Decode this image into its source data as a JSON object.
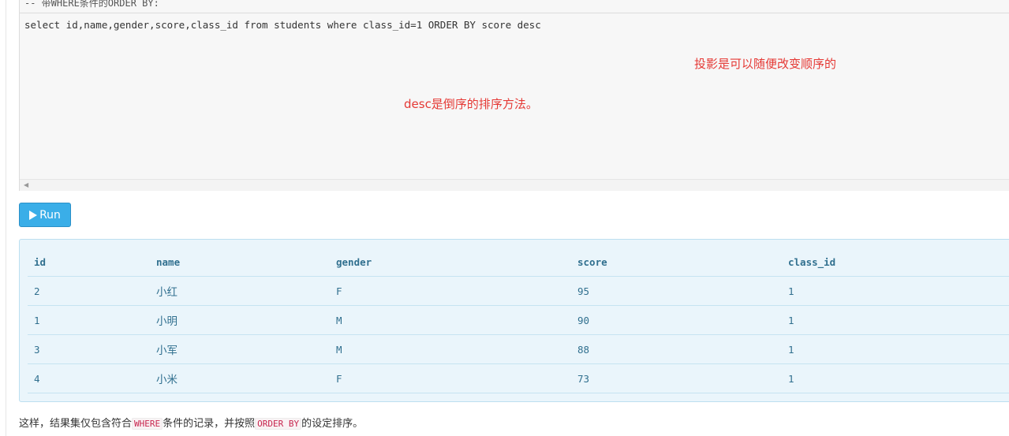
{
  "editor": {
    "comment": "-- 带WHERE条件的ORDER BY:",
    "code": "select id,name,gender,score,class_id from students where class_id=1 ORDER BY score desc"
  },
  "annotations": {
    "projection_note": "投影是可以随便改变顺序的",
    "desc_note": "desc是倒序的排序方法。"
  },
  "run_button": {
    "label": "Run",
    "color": "#3aaee8"
  },
  "result": {
    "columns": [
      "id",
      "name",
      "gender",
      "score",
      "class_id"
    ],
    "rows": [
      [
        "2",
        "小红",
        "F",
        "95",
        "1"
      ],
      [
        "1",
        "小明",
        "M",
        "90",
        "1"
      ],
      [
        "3",
        "小军",
        "M",
        "88",
        "1"
      ],
      [
        "4",
        "小米",
        "F",
        "73",
        "1"
      ]
    ]
  },
  "footer": {
    "text_1": "这样，结果集仅包含符合",
    "code_1": "WHERE",
    "text_2": "条件的记录，并按照",
    "code_2": "ORDER BY",
    "text_3": "的设定排序。"
  },
  "colors": {
    "annotation": "#e53935",
    "result_text": "#31708f",
    "result_bg": "#eaf5fb"
  }
}
